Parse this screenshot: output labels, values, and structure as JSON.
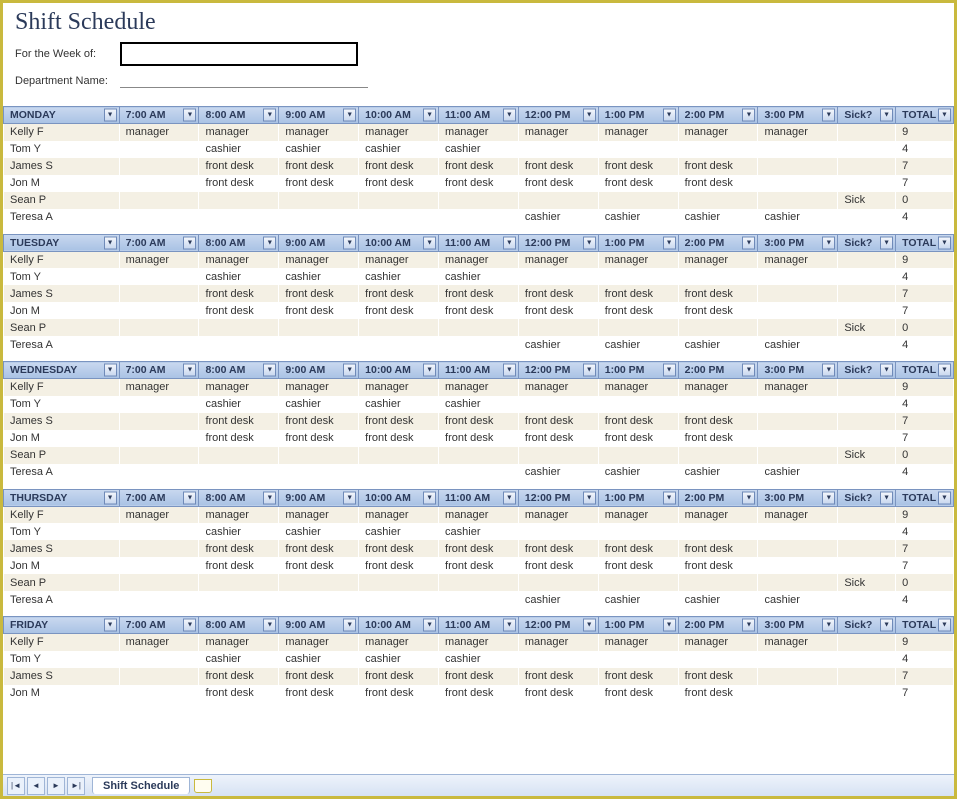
{
  "title": "Shift Schedule",
  "meta": {
    "week_label": "For the Week of:",
    "dept_label": "Department Name:"
  },
  "hour_headers": [
    "7:00 AM",
    "8:00 AM",
    "9:00 AM",
    "10:00 AM",
    "11:00 AM",
    "12:00 PM",
    "1:00 PM",
    "2:00 PM",
    "3:00 PM"
  ],
  "sick_header": "Sick?",
  "total_header": "TOTAL",
  "day_pattern": {
    "rows": [
      {
        "name": "Kelly F",
        "cells": [
          "manager",
          "manager",
          "manager",
          "manager",
          "manager",
          "manager",
          "manager",
          "manager",
          "manager"
        ],
        "sick": "",
        "total": "9"
      },
      {
        "name": "Tom Y",
        "cells": [
          "",
          "cashier",
          "cashier",
          "cashier",
          "cashier",
          "",
          "",
          "",
          ""
        ],
        "sick": "",
        "total": "4"
      },
      {
        "name": "James S",
        "cells": [
          "",
          "front desk",
          "front desk",
          "front desk",
          "front desk",
          "front desk",
          "front desk",
          "front desk",
          ""
        ],
        "sick": "",
        "total": "7"
      },
      {
        "name": "Jon M",
        "cells": [
          "",
          "front desk",
          "front desk",
          "front desk",
          "front desk",
          "front desk",
          "front desk",
          "front desk",
          ""
        ],
        "sick": "",
        "total": "7"
      },
      {
        "name": "Sean P",
        "cells": [
          "",
          "",
          "",
          "",
          "",
          "",
          "",
          "",
          ""
        ],
        "sick": "Sick",
        "total": "0"
      },
      {
        "name": "Teresa A",
        "cells": [
          "",
          "",
          "",
          "",
          "",
          "cashier",
          "cashier",
          "cashier",
          "cashier"
        ],
        "sick": "",
        "total": "4"
      }
    ]
  },
  "days": [
    {
      "label": "MONDAY",
      "row_count": 6
    },
    {
      "label": "TUESDAY",
      "row_count": 6
    },
    {
      "label": "WEDNESDAY",
      "row_count": 6
    },
    {
      "label": "THURSDAY",
      "row_count": 6
    },
    {
      "label": "FRIDAY",
      "row_count": 4
    }
  ],
  "sheet_tab": "Shift Schedule"
}
